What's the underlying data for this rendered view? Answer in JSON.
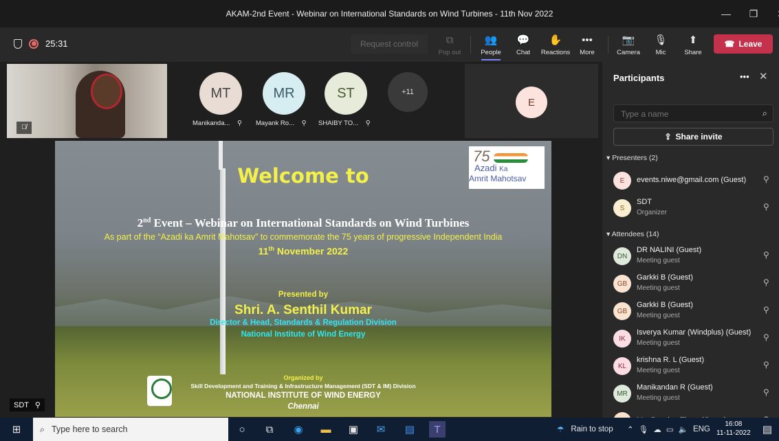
{
  "window": {
    "title": "AKAM-2nd Event - Webinar on International Standards on Wind Turbines - 11th Nov 2022"
  },
  "toolbar": {
    "timer": "25:31",
    "request_control": "Request control",
    "popout": "Pop out",
    "people": "People",
    "chat": "Chat",
    "reactions": "Reactions",
    "more": "More",
    "camera": "Camera",
    "mic": "Mic",
    "share": "Share",
    "leave": "Leave"
  },
  "gallery": {
    "tiles": [
      {
        "initials": "MT",
        "name": "Manikanda...",
        "color": "#e9dcd4"
      },
      {
        "initials": "MR",
        "name": "Mayank Ro...",
        "color": "#d6eef2"
      },
      {
        "initials": "ST",
        "name": "SHAIBY TO...",
        "color": "#e6ecd9"
      }
    ],
    "overflow": "+11",
    "speaker_initial": "E",
    "self_label": "SDT"
  },
  "slide": {
    "welcome": "Welcome to",
    "logo_num": "75",
    "logo_line1": "Azadi",
    "logo_ka": "Ka",
    "logo_line2a": "Amrit",
    "logo_line2b": "Mahotsav",
    "event_num": "2",
    "event_sup": "nd",
    "event_rest": " Event – Webinar on International Standards on Wind Turbines",
    "subtitle": "As part of the “Azadi ka Amrit Mahotsav” to commemorate the 75 years of progressive Independent India",
    "date_num": "11",
    "date_sup": "th",
    "date_rest": " November 2022",
    "presented_by": "Presented by",
    "presenter": "Shri. A. Senthil Kumar",
    "role": "Director & Head, Standards & Regulation Division",
    "institute": "National Institute of Wind Energy",
    "organized_by": "Organized by",
    "division": "Skill Development and Training & Infrastructure Management (SDT & IM) Division",
    "org_name": "NATIONAL INSTITUTE OF WIND ENERGY",
    "city": "Chennai"
  },
  "panel": {
    "title": "Participants",
    "search_placeholder": "Type a name",
    "share_invite": "Share invite",
    "presenters_label": "Presenters (2)",
    "attendees_label": "Attendees (14)",
    "presenters": [
      {
        "initials": "E",
        "name": "events.niwe@gmail.com (Guest)",
        "sub": "",
        "color": "#fde3dd",
        "text": "#8a3b2f"
      },
      {
        "initials": "S",
        "name": "SDT",
        "sub": "Organizer",
        "color": "#fbeed0",
        "text": "#8a6a1a"
      }
    ],
    "attendees": [
      {
        "initials": "DN",
        "name": "DR NALINI (Guest)",
        "sub": "Meeting guest",
        "color": "#dfe9dc",
        "text": "#3a5a34"
      },
      {
        "initials": "GB",
        "name": "Garkki B (Guest)",
        "sub": "Meeting guest",
        "color": "#fbe3d1",
        "text": "#8a4a2a"
      },
      {
        "initials": "GB",
        "name": "Garkki B (Guest)",
        "sub": "Meeting guest",
        "color": "#fbe3d1",
        "text": "#8a4a2a"
      },
      {
        "initials": "IK",
        "name": "Isverya Kumar (Windplus) (Guest)",
        "sub": "Meeting guest",
        "color": "#fbdde3",
        "text": "#8a2a3f"
      },
      {
        "initials": "KL",
        "name": "krishna R. L (Guest)",
        "sub": "Meeting guest",
        "color": "#fbdde3",
        "text": "#8a2a3f"
      },
      {
        "initials": "MR",
        "name": "Manikandan R (Guest)",
        "sub": "Meeting guest",
        "color": "#dfe9dc",
        "text": "#3a5a34"
      },
      {
        "initials": "",
        "name": "Manikandan Tha... (Guest)",
        "sub": "",
        "color": "#fbe3d1",
        "text": "#8a4a2a"
      }
    ]
  },
  "taskbar": {
    "search_placeholder": "Type here to search",
    "weather": "Rain to stop",
    "lang": "ENG",
    "time": "16:08",
    "date": "11-11-2022"
  }
}
